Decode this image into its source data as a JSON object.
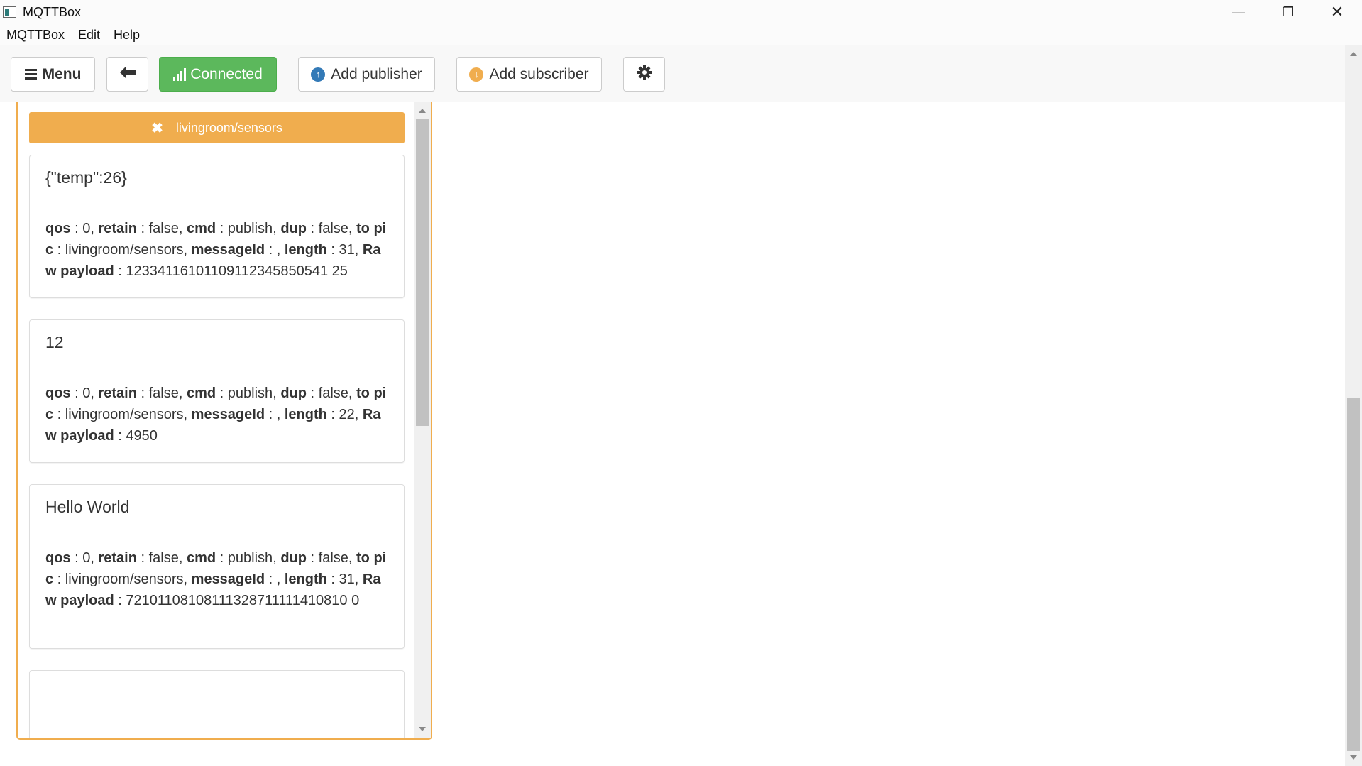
{
  "window": {
    "title": "MQTTBox",
    "minimize_glyph": "—",
    "maximize_glyph": "❐",
    "close_glyph": "✕"
  },
  "menubar": {
    "items": [
      "MQTTBox",
      "Edit",
      "Help"
    ]
  },
  "toolbar": {
    "menu_label": "Menu",
    "connected_label": "Connected",
    "add_publisher_label": "Add publisher",
    "add_subscriber_label": "Add subscriber",
    "colors": {
      "connected": "#5cb85c",
      "publisher_icon": "#337ab7",
      "subscriber_icon": "#f0ad4e"
    }
  },
  "subscriber": {
    "topic": "livingroom/sensors",
    "accent_color": "#f0ad4e",
    "messages": [
      {
        "payload": "{\"temp\":26}",
        "qos": "0",
        "retain": "false",
        "cmd": "publish",
        "dup": "false",
        "topic": "livingroom/sensors",
        "messageId": "",
        "length": "31",
        "raw_payload": "12334116101109112345850541 25"
      },
      {
        "payload": "12",
        "qos": "0",
        "retain": "false",
        "cmd": "publish",
        "dup": "false",
        "topic": "livingroom/sensors",
        "messageId": "",
        "length": "22",
        "raw_payload": "4950"
      },
      {
        "payload": "Hello World",
        "qos": "0",
        "retain": "false",
        "cmd": "publish",
        "dup": "false",
        "topic": "livingroom/sensors",
        "messageId": "",
        "length": "31",
        "raw_payload": "72101108108111328711111410810 0"
      }
    ]
  }
}
